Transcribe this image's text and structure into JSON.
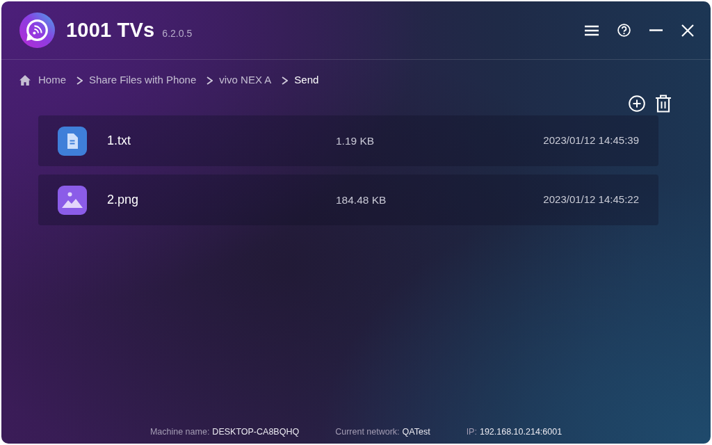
{
  "window": {
    "title": "1001 TVs",
    "version": "6.2.0.5"
  },
  "breadcrumb": [
    {
      "label": "Home",
      "kind": "home",
      "selected": false
    },
    {
      "label": "Share Files with Phone",
      "kind": "page",
      "selected": false
    },
    {
      "label": "vivo NEX A",
      "kind": "page",
      "selected": false
    },
    {
      "label": "Send",
      "kind": "page",
      "selected": true
    }
  ],
  "files": [
    {
      "name": "1.txt",
      "kind": "text",
      "size": "1.19 KB",
      "date": "2023/01/12 14:45:39"
    },
    {
      "name": "2.png",
      "kind": "image",
      "size": "184.48 KB",
      "date": "2023/01/12 14:45:22"
    }
  ],
  "status_bar": [
    {
      "label": "Machine name:",
      "value": "DESKTOP-CA8BQHQ"
    },
    {
      "label": "Current network:",
      "value": "QATest"
    },
    {
      "label": "IP:",
      "value": "192.168.10.214:6001"
    }
  ]
}
